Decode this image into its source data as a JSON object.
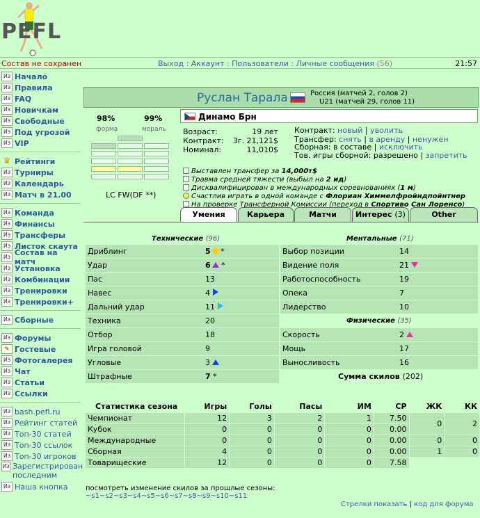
{
  "logo": {
    "text": "PEFL"
  },
  "topbar": {
    "unsaved": "Состав не сохранен",
    "nav": [
      "Выход",
      "Аккаунт",
      "Пользователи",
      "Личные сообщения"
    ],
    "messages_count": "(56)",
    "time": "21:57"
  },
  "sidebar": {
    "group1": [
      "Начало",
      "Правила",
      "FAQ",
      "Новичкам",
      "Свободные",
      "Под угрозой",
      "VIP"
    ],
    "group2": [
      "Рейтинги",
      "Турниры",
      "Календарь",
      "Матч в 21.00"
    ],
    "group3": [
      "Команда",
      "Финансы",
      "Трансферы",
      "Листок скаута",
      "Состав на матч",
      "Установка",
      "Комбинации",
      "Тренировки",
      "Тренировки+"
    ],
    "group4": [
      "Сборные"
    ],
    "group5": [
      "Форумы",
      "Гостевые",
      "Фотогалерея",
      "Чат",
      "Статьи",
      "Ссылки"
    ],
    "group6": [
      "bash.pefl.ru",
      "Рейтинг статей",
      "Топ-30 статей",
      "Топ-30 ссылок",
      "Топ-30 игроков",
      "Зарегистрирован последним",
      "Наша кнопка"
    ],
    "icon_text": "Из"
  },
  "player": {
    "name": "Руслан Тарала",
    "country_line1": "Россия (матчей 2, голов 2)",
    "country_line2": "U21 (матчей 29, голов 11)",
    "form_value": "98%",
    "form_label": "форма",
    "morale_value": "99%",
    "morale_label": "мораль",
    "position": "LC FW(DF **)",
    "club": "Динамо Брн"
  },
  "info": {
    "age_label": "Возраст:",
    "age": "19 лет",
    "contract_label": "Контракт:",
    "contract": "3г. 21,121$",
    "nominal_label": "Номинал:",
    "nominal": "11,010$",
    "c_label": "Контракт:",
    "c_new": "новый",
    "c_fire": "уволить",
    "t_label": "Трансфер:",
    "t_remove": "снять",
    "t_rent": "в аренду",
    "t_unneeded": "ненужен",
    "n_label": "Сборная:",
    "n_status": "в составе",
    "n_exclude": "исключить",
    "g_label": "Тов. игры сборной:",
    "g_status": "разрешено",
    "g_forbid": "запретить"
  },
  "events": [
    {
      "pre": "Выставлен трансфер за ",
      "bold": "14,000т$",
      "post": ""
    },
    {
      "pre": "Травма средней тяжести (выбыл на ",
      "bold": "2 ид",
      "post": ")"
    },
    {
      "pre": "Дисквалифицирован в международных соревнованиях (",
      "bold": "1 м",
      "post": ")"
    },
    {
      "pre": "Счастлив играть в одной команде с ",
      "bold": "Флориан Химмелфройндпойнтнер",
      "post": ""
    },
    {
      "pre": "На проверке Трансферной Комиссии (переход в ",
      "bold": "Спортиво Сан Лоренсо",
      "post": ")"
    }
  ],
  "tabs": [
    "Умения",
    "Карьера",
    "Матчи",
    "Интерес",
    "Other"
  ],
  "tab_interest_count": "(3)",
  "skills": {
    "tech_title": "Технические",
    "tech_sum": "(96)",
    "mental_title": "Ментальные",
    "mental_sum": "(71)",
    "phys_title": "Физические",
    "phys_sum": "(35)",
    "total_label": "Сумма скилов",
    "total": "(202)",
    "technical": [
      {
        "name": "Дриблинг",
        "value": "5",
        "mark": "star",
        "note": "*"
      },
      {
        "name": "Удар",
        "value": "6",
        "mark": "up-purple",
        "note": "*"
      },
      {
        "name": "Пас",
        "value": "13",
        "mark": "",
        "note": ""
      },
      {
        "name": "Навес",
        "value": "4",
        "mark": "right-blue",
        "note": ""
      },
      {
        "name": "Дальний удар",
        "value": "11",
        "mark": "right-cyan",
        "note": ""
      },
      {
        "name": "Техника",
        "value": "20",
        "mark": "",
        "note": ""
      },
      {
        "name": "Отбор",
        "value": "18",
        "mark": "",
        "note": ""
      },
      {
        "name": "Игра головой",
        "value": "9",
        "mark": "",
        "note": ""
      },
      {
        "name": "Угловые",
        "value": "3",
        "mark": "up-blue",
        "note": ""
      },
      {
        "name": "Штрафные",
        "value": "7",
        "mark": "",
        "note": "*"
      }
    ],
    "mental": [
      {
        "name": "Выбор позиции",
        "value": "14",
        "mark": ""
      },
      {
        "name": "Видение поля",
        "value": "21",
        "mark": "down-pink"
      },
      {
        "name": "Работоспособность",
        "value": "19",
        "mark": ""
      },
      {
        "name": "Опека",
        "value": "7",
        "mark": ""
      },
      {
        "name": "Лидерство",
        "value": "10",
        "mark": ""
      }
    ],
    "physical": [
      {
        "name": "Скорость",
        "value": "2",
        "mark": "up-pink"
      },
      {
        "name": "Мощь",
        "value": "17",
        "mark": ""
      },
      {
        "name": "Выносливость",
        "value": "16",
        "mark": ""
      }
    ]
  },
  "season": {
    "headers": [
      "Статистика сезона",
      "Игры",
      "Голы",
      "Пасы",
      "ИМ",
      "СР",
      "ЖК",
      "КК"
    ],
    "rows": [
      [
        "Чемпионат",
        "12",
        "3",
        "2",
        "1",
        "7.50"
      ],
      [
        "Кубок",
        "0",
        "0",
        "0",
        "0",
        "0.00"
      ],
      [
        "Международные",
        "0",
        "0",
        "0",
        "0",
        "0.00"
      ],
      [
        "Сборная",
        "4",
        "0",
        "0",
        "0",
        "0.00"
      ],
      [
        "Товарищеские",
        "12",
        "0",
        "0",
        "0",
        "7.58"
      ]
    ],
    "cards": [
      [
        "0",
        "2"
      ],
      [
        "0",
        "0"
      ],
      [
        "1",
        "0"
      ]
    ]
  },
  "footer": {
    "history_text": "посмотреть изменение скилов за прошлые сезоны:",
    "seasons": [
      "~s1",
      "~s2",
      "~s3",
      "~s4",
      "~s5",
      "~s6",
      "~s7",
      "~s8",
      "~s9",
      "~s10",
      "~s11"
    ],
    "arrows_link": "Стрелки показать",
    "forum_code": "код для форума"
  },
  "colors": {
    "accent_link": "#3a5fa0",
    "row_bg": "#b5e5b5",
    "page_bg": "#ccffcc"
  }
}
